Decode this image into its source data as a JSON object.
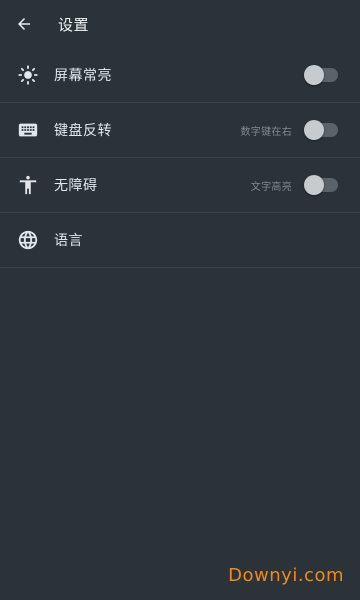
{
  "header": {
    "back_icon": "arrow-left-icon",
    "title": "设置"
  },
  "settings": [
    {
      "icon": "brightness-icon",
      "label": "屏幕常亮",
      "sub": "",
      "toggle": false
    },
    {
      "icon": "keyboard-icon",
      "label": "键盘反转",
      "sub": "数字键在右",
      "toggle": false
    },
    {
      "icon": "accessibility-icon",
      "label": "无障碍",
      "sub": "文字高亮",
      "toggle": false
    },
    {
      "icon": "globe-icon",
      "label": "语言",
      "sub": ""
    }
  ],
  "watermark": "Downyi.com",
  "colors": {
    "background": "#2b3339",
    "divider": "#3a4349",
    "watermark": "#f08a1c",
    "toggle_track": "#5b6368",
    "toggle_knob": "#c7cbce"
  }
}
